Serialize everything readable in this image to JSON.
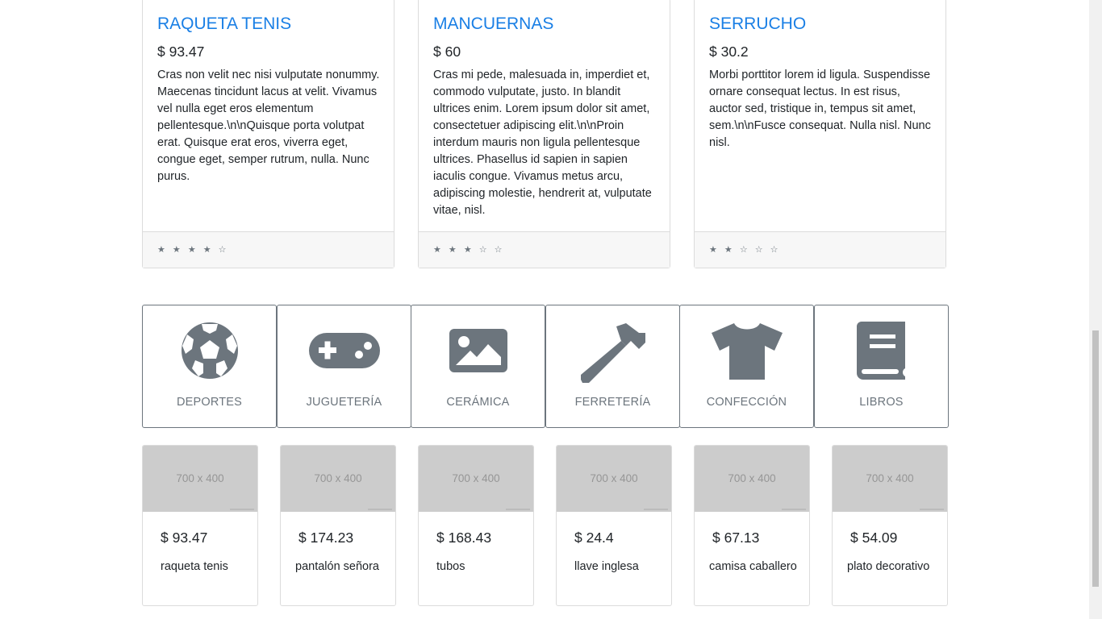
{
  "products": [
    {
      "title": "RAQUETA TENIS",
      "price": "$ 93.47",
      "description": "Cras non velit nec nisi vulputate nonummy. Maecenas tincidunt lacus at velit. Vivamus vel nulla eget eros elementum pellentesque.\\n\\nQuisque porta volutpat erat. Quisque erat eros, viverra eget, congue eget, semper rutrum, nulla. Nunc purus.",
      "stars": "★ ★ ★ ★ ☆",
      "rating": 4
    },
    {
      "title": "MANCUERNAS",
      "price": "$ 60",
      "description": "Cras mi pede, malesuada in, imperdiet et, commodo vulputate, justo. In blandit ultrices enim. Lorem ipsum dolor sit amet, consectetuer adipiscing elit.\\n\\nProin interdum mauris non ligula pellentesque ultrices. Phasellus id sapien in sapien iaculis congue. Vivamus metus arcu, adipiscing molestie, hendrerit at, vulputate vitae, nisl.",
      "stars": "★ ★ ★ ☆ ☆",
      "rating": 3
    },
    {
      "title": "SERRUCHO",
      "price": "$ 30.2",
      "description": "Morbi porttitor lorem id ligula. Suspendisse ornare consequat lectus. In est risus, auctor sed, tristique in, tempus sit amet, sem.\\n\\nFusce consequat. Nulla nisl. Nunc nisl.",
      "stars": "★ ★ ☆ ☆ ☆",
      "rating": 2
    }
  ],
  "categories": [
    {
      "label": "DEPORTES",
      "icon": "soccer-ball-icon"
    },
    {
      "label": "JUGUETERÍA",
      "icon": "gamepad-icon"
    },
    {
      "label": "CERÁMICA",
      "icon": "image-icon"
    },
    {
      "label": "FERRETERÍA",
      "icon": "hammer-icon"
    },
    {
      "label": "CONFECCIÓN",
      "icon": "tshirt-icon"
    },
    {
      "label": "LIBROS",
      "icon": "book-icon"
    }
  ],
  "mini_products": [
    {
      "placeholder": "700 x 400",
      "price": "$ 93.47",
      "name": "raqueta tenis"
    },
    {
      "placeholder": "700 x 400",
      "price": "$ 174.23",
      "name": " pantalón señora"
    },
    {
      "placeholder": "700 x 400",
      "price": "$ 168.43",
      "name": "tubos"
    },
    {
      "placeholder": "700 x 400",
      "price": "$ 24.4",
      "name": "llave inglesa"
    },
    {
      "placeholder": "700 x 400",
      "price": "$ 67.13",
      "name": " camisa caballero"
    },
    {
      "placeholder": "700 x 400",
      "price": "$ 54.09",
      "name": " plato decorativo"
    }
  ],
  "colors": {
    "link": "#1a7fe5",
    "icon": "#6c757d",
    "placeholder_bg": "#cccccc"
  }
}
